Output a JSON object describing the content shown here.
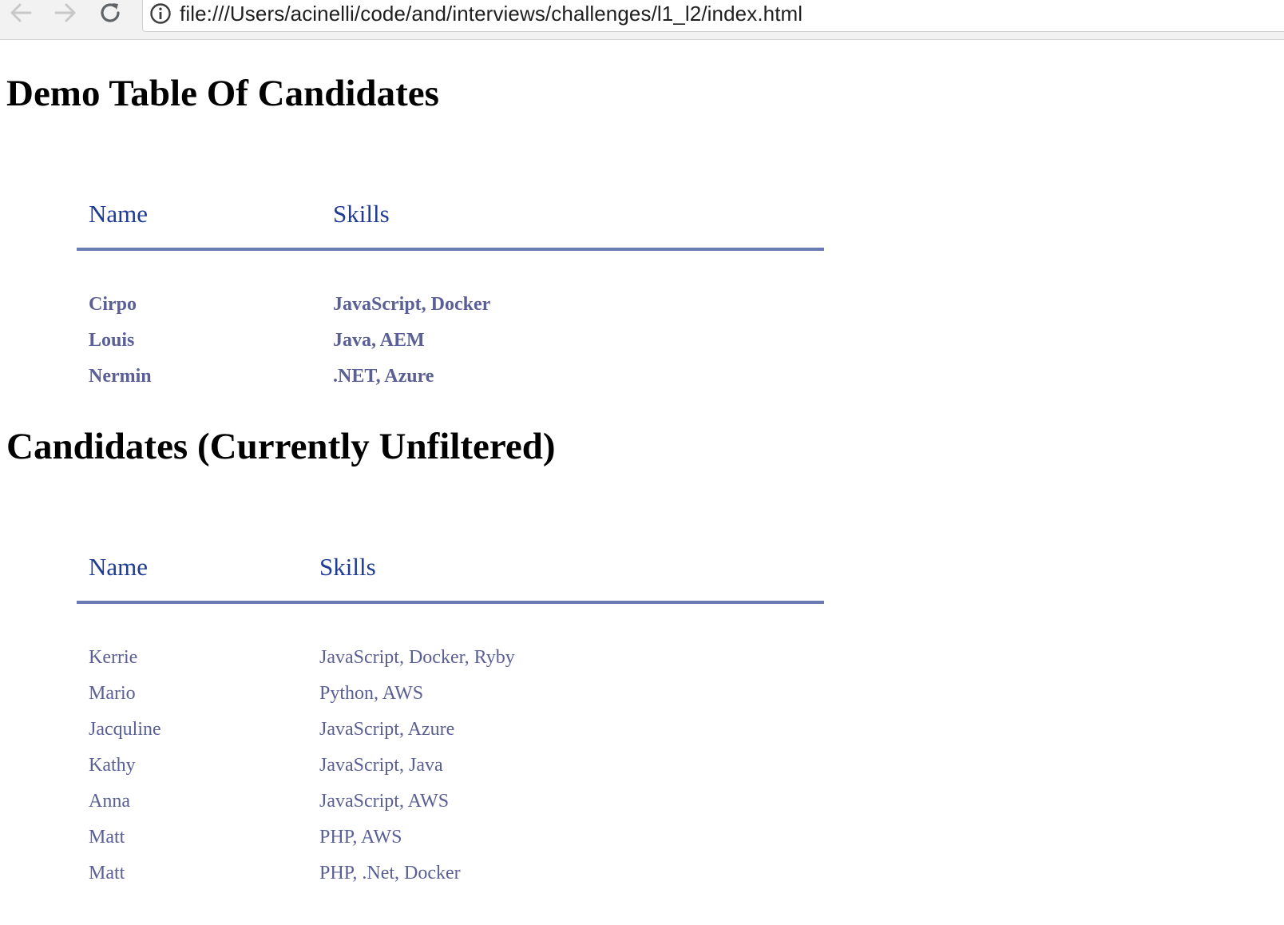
{
  "browser": {
    "url": "file:///Users/acinelli/code/and/interviews/challenges/l1_l2/index.html",
    "icons": {
      "back": "arrow-left-icon",
      "forward": "arrow-right-icon",
      "reload": "reload-icon",
      "info": "info-icon"
    }
  },
  "demo": {
    "title": "Demo Table Of Candidates",
    "headers": {
      "name": "Name",
      "skills": "Skills"
    },
    "rows": [
      {
        "name": "Cirpo",
        "skills": "JavaScript, Docker"
      },
      {
        "name": "Louis",
        "skills": "Java, AEM"
      },
      {
        "name": "Nermin",
        "skills": ".NET, Azure"
      }
    ]
  },
  "candidates": {
    "title": "Candidates (Currently Unfiltered)",
    "headers": {
      "name": "Name",
      "skills": "Skills"
    },
    "rows": [
      {
        "name": "Kerrie",
        "skills": "JavaScript, Docker, Ryby"
      },
      {
        "name": "Mario",
        "skills": "Python, AWS"
      },
      {
        "name": "Jacquline",
        "skills": "JavaScript, Azure"
      },
      {
        "name": "Kathy",
        "skills": "JavaScript, Java"
      },
      {
        "name": "Anna",
        "skills": "JavaScript, AWS"
      },
      {
        "name": "Matt",
        "skills": "PHP, AWS"
      },
      {
        "name": "Matt",
        "skills": "PHP, .Net, Docker"
      }
    ]
  },
  "colors": {
    "header_text": "#1f3b95",
    "header_rule": "#6a7bb3",
    "cell_text": "#5a5f95"
  }
}
